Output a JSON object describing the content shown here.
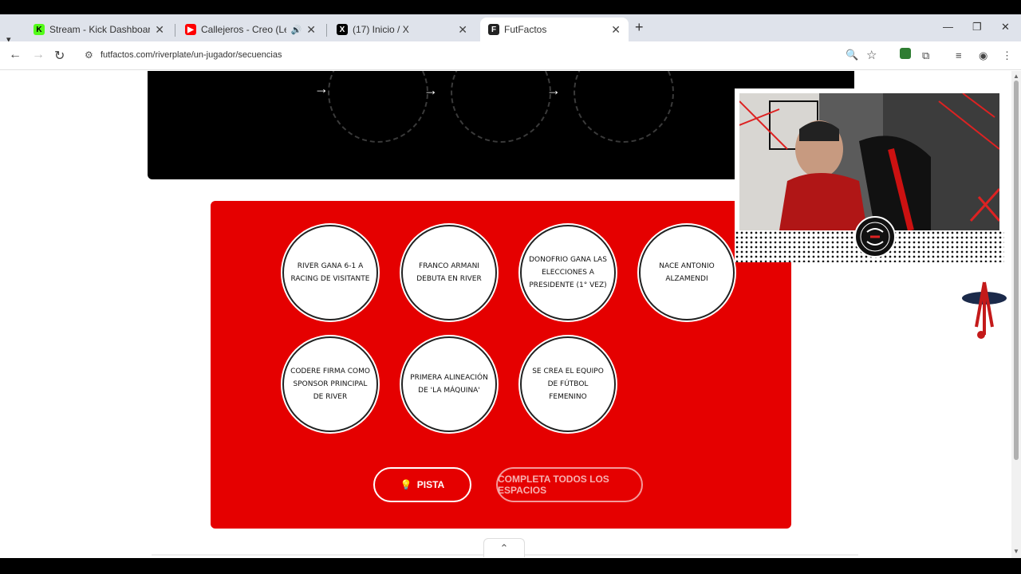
{
  "browser": {
    "tabs": [
      {
        "title": "Stream - Kick Dashboard",
        "icon": "kick-icon",
        "color": "#53fc18"
      },
      {
        "title": "Callejeros - Creo (Letra) - Yo",
        "icon": "youtube-icon",
        "color": "#ff0000"
      },
      {
        "title": "(17) Inicio / X",
        "icon": "x-icon",
        "color": "#000000"
      },
      {
        "title": "FutFactos",
        "icon": "futfactos-icon",
        "color": "#222222"
      }
    ],
    "url": "futfactos.com/riverplate/un-jugador/secuencias"
  },
  "sequence": {
    "events": [
      "RIVER GANA 6-1 A RACING DE VISITANTE",
      "FRANCO ARMANI DEBUTA EN RIVER",
      "DONOFRIO GANA LAS ELECCIONES A PRESIDENTE (1° VEZ)",
      "NACE ANTONIO ALZAMENDI",
      "CODERE FIRMA COMO SPONSOR PRINCIPAL DE RIVER",
      "PRIMERA ALINEACIÓN DE 'LA MÁQUINA'",
      "SE CREA EL EQUIPO DE FÚTBOL FEMENINO"
    ],
    "hint_label": "PISTA",
    "complete_label": "COMPLETA TODOS LOS ESPACIOS"
  },
  "colors": {
    "primary_red": "#e50000"
  }
}
